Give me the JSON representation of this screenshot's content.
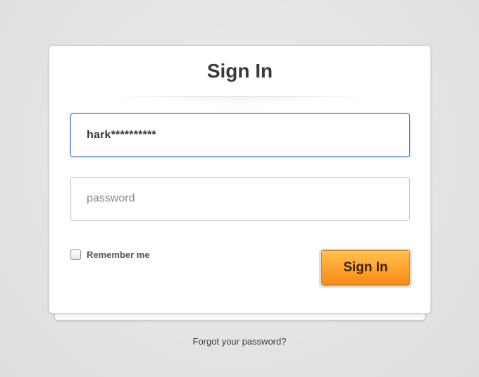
{
  "form": {
    "title": "Sign In",
    "username_value": "hark**********",
    "password_placeholder": "password",
    "remember_label": "Remember me",
    "remember_checked": false,
    "submit_label": "Sign In"
  },
  "footer": {
    "forgot_link": "Forgot your password?"
  },
  "colors": {
    "button": "#ffa22a",
    "focus_border": "#2f63d6",
    "background": "#e4e4e4"
  }
}
